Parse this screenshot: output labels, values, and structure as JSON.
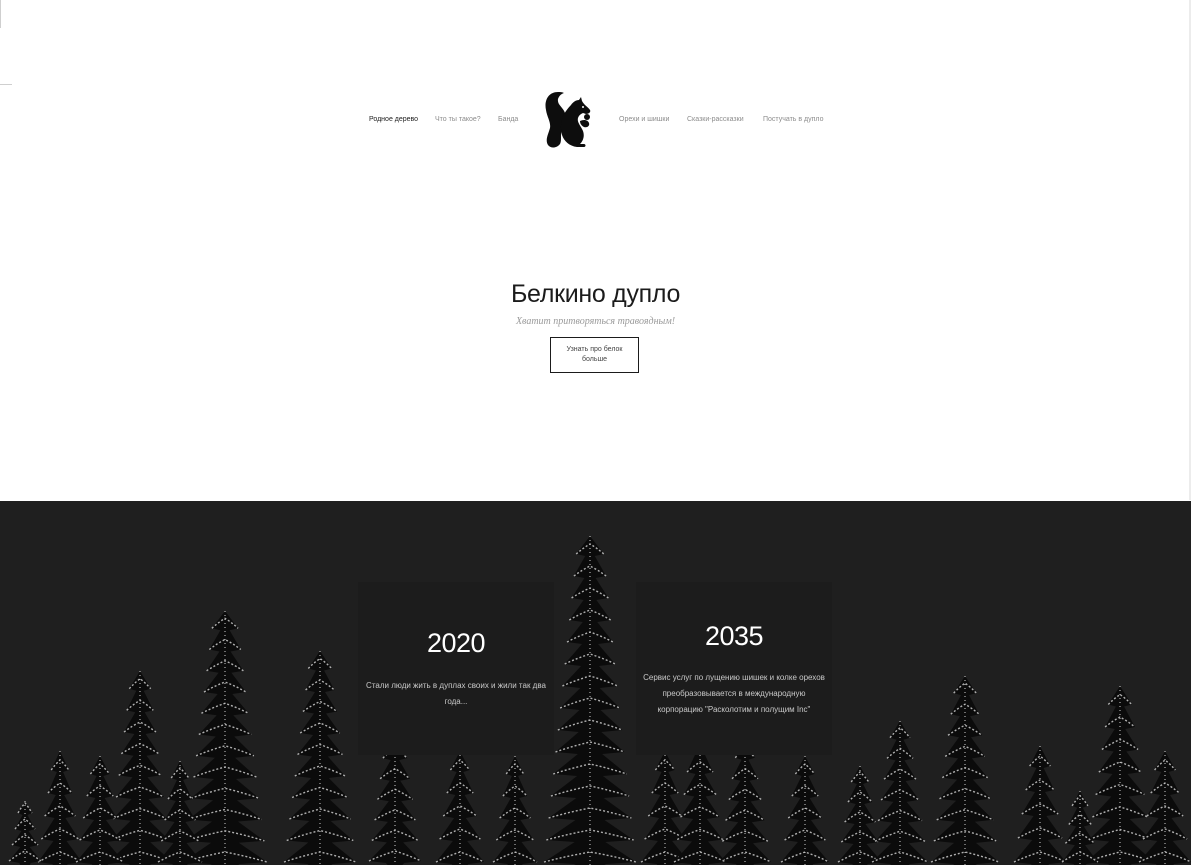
{
  "nav": {
    "items": [
      {
        "label": "Родное дерево",
        "active": true
      },
      {
        "label": "Что ты такое?"
      },
      {
        "label": "Банда"
      },
      {
        "label": "Орехи и шишки"
      },
      {
        "label": "Сказки-рассказки"
      },
      {
        "label": "Постучать в дупло"
      }
    ],
    "logo_icon": "squirrel-icon"
  },
  "hero": {
    "title": "Белкино дупло",
    "subtitle": "Хватит притворяться травоядным!",
    "button_label": "Узнать про белок больше"
  },
  "timeline": {
    "cards": [
      {
        "year": "2020",
        "text": "Стали люди жить в дуплах своих и жили так два года..."
      },
      {
        "year": "2035",
        "text": "Сервис услуг по лущению шишек и колке орехов преобразовывается в международную корпорацию \"Расколотим и полущим Inc\""
      }
    ]
  },
  "colors": {
    "forest_bg": "#1f1f1f",
    "card_bg": "#1c1c1c",
    "text_dark": "#1b1b1b",
    "nav_inactive": "#8c8c8c"
  }
}
